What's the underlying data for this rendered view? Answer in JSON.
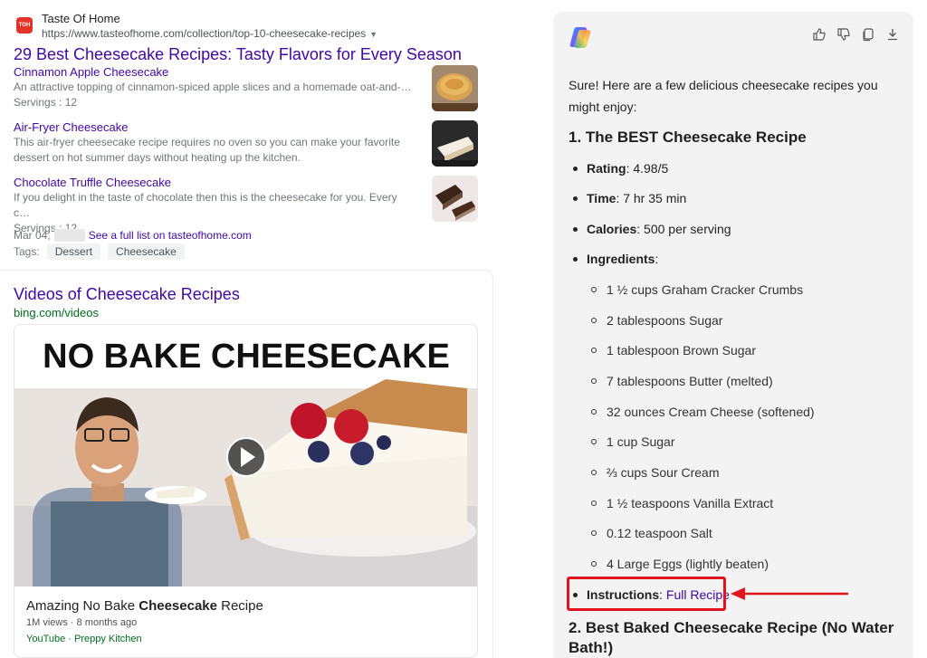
{
  "search_result": {
    "site_name": "Taste Of Home",
    "site_url": "https://www.tasteofhome.com/collection/top-10-cheesecake-recipes",
    "title": "29 Best Cheesecake Recipes: Tasty Flavors for Every Season",
    "items": [
      {
        "title": "Cinnamon Apple Cheesecake",
        "desc": "An attractive topping of cinnamon-spiced apple slices and a homemade oat-and-…",
        "servings": "Servings : 12"
      },
      {
        "title": "Air-Fryer Cheesecake",
        "desc": "This air-fryer cheesecake recipe requires no oven so you can make your favorite dessert on hot summer days without heating up the kitchen.",
        "servings": ""
      },
      {
        "title": "Chocolate Truffle Cheesecake",
        "desc": "If you delight in the taste of chocolate then this is the cheesecake for you. Every c…",
        "servings": "Servings : 12"
      }
    ],
    "date": "Mar 04,",
    "full_list_link": "See a full list on tasteofhome.com",
    "tags_label": "Tags:",
    "tags": [
      "Dessert",
      "Cheesecake"
    ]
  },
  "videos": {
    "title": "Videos of Cheesecake Recipes",
    "source": "bing.com/videos",
    "thumb_caption": "NO BAKE CHEESECAKE",
    "video_title_prefix": "Amazing No Bake ",
    "video_title_bold": "Cheesecake",
    "video_title_suffix": " Recipe",
    "views": "1M views · 8 months ago",
    "channel": "YouTube · Preppy Kitchen"
  },
  "copilot": {
    "toolbar_icons": [
      "thumbs-up-icon",
      "thumbs-down-icon",
      "copy-icon",
      "download-icon"
    ],
    "intro": "Sure! Here are a few delicious cheesecake recipes you might enjoy:",
    "recipe1_title": "1. The BEST Cheesecake Recipe",
    "rating_label": "Rating",
    "rating_value": ": 4.98/5",
    "time_label": "Time",
    "time_value": ": 7 hr 35 min",
    "calories_label": "Calories",
    "calories_value": ": 500 per serving",
    "ingredients_label": "Ingredients",
    "ingredients_suffix": ":",
    "ingredients": [
      "1 ½ cups Graham Cracker Crumbs",
      "2 tablespoons Sugar",
      "1 tablespoon Brown Sugar",
      "7 tablespoons Butter (melted)",
      "32 ounces Cream Cheese (softened)",
      "1 cup Sugar",
      "⅔ cups Sour Cream",
      "1 ½ teaspoons Vanilla Extract",
      "0.12 teaspoon Salt",
      "4 Large Eggs (lightly beaten)"
    ],
    "instructions_label": "Instructions",
    "instructions_sep": ": ",
    "instructions_link": "Full Recipe",
    "recipe2_title": "2. Best Baked Cheesecake Recipe (No Water Bath!)"
  },
  "colors": {
    "link": "#4007a2",
    "source_green": "#006d21",
    "highlight_red": "#e3141d",
    "panel_bg": "#f3f3f3"
  }
}
